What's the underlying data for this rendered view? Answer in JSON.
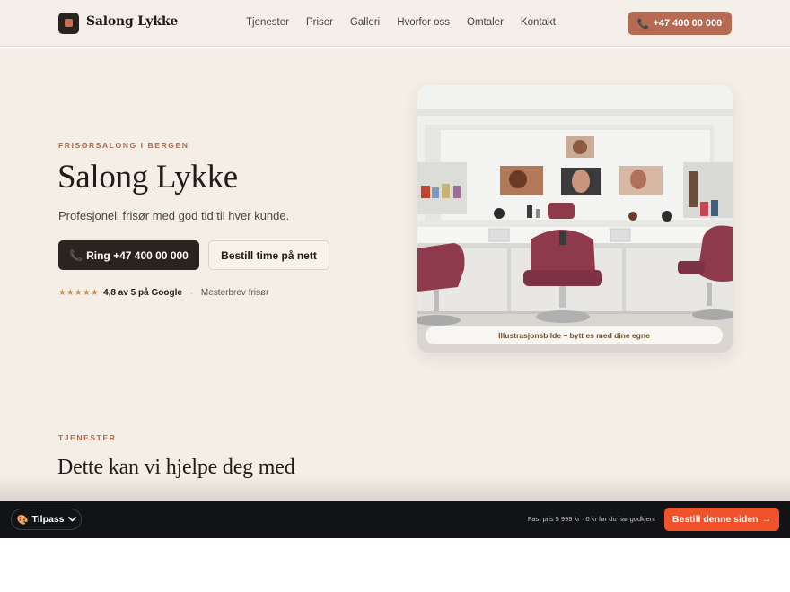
{
  "header": {
    "brand": "Salong Lykke",
    "nav": [
      "Tjenester",
      "Priser",
      "Galleri",
      "Hvorfor oss",
      "Omtaler",
      "Kontakt"
    ],
    "phone_button": "+47 400 00 000",
    "phone_icon": "phone-icon"
  },
  "hero": {
    "eyebrow": "FRISØRSALONG I BERGEN",
    "title": "Salong Lykke",
    "subtitle": "Profesjonell frisør med god tid til hver kunde.",
    "primary_button": "Ring +47 400 00 000",
    "secondary_button": "Bestill time på nett",
    "stars": "★★★★★",
    "rating_text": "4,8 av 5 på Google",
    "rating_separator": "·",
    "rating_note": "Mesterbrev frisør",
    "image_caption": "Illustrasjonsbilde – bytt es med dine egne"
  },
  "services": {
    "eyebrow": "TJENESTER",
    "title": "Dette kan vi hjelpe deg med"
  },
  "bottom_bar": {
    "customize_label": "Tilpass",
    "customize_icon": "palette-icon",
    "price_note": "Fast pris 5 999 kr · 0 kr før du har godkjent",
    "cta_label": "Bestill denne siden",
    "cta_arrow": "→"
  },
  "colors": {
    "accent": "#b66a52",
    "dark": "#2a2320",
    "cta": "#f0522b",
    "background": "#f4eee7"
  }
}
